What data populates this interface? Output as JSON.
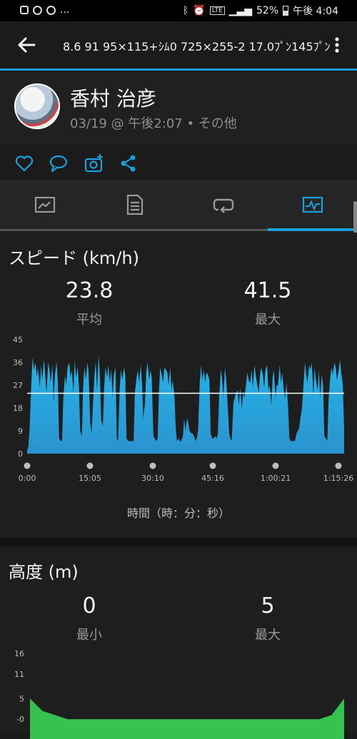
{
  "status_bar": {
    "left": "...",
    "battery": "52%",
    "time": "午後 4:04"
  },
  "app_bar": {
    "title": "8.6 91 95×115+ｼﾑ0 725×255-2 17.0ﾌﾟﾝ145ﾌﾟﾝ"
  },
  "activity": {
    "user_name": "香村 治彦",
    "meta": "03/19 @ 午後2:07 • その他"
  },
  "actions": [
    "like-icon",
    "comment-icon",
    "add-photo-icon",
    "share-icon"
  ],
  "tabs": [
    {
      "name": "overview-tab",
      "icon": "map-icon",
      "active": false
    },
    {
      "name": "details-tab",
      "icon": "list-icon",
      "active": false
    },
    {
      "name": "laps-tab",
      "icon": "laps-icon",
      "active": false
    },
    {
      "name": "charts-tab",
      "icon": "chart-icon",
      "active": true
    }
  ],
  "speed": {
    "title": "スピード (km/h)",
    "avg_value": "23.8",
    "avg_label": "平均",
    "max_value": "41.5",
    "max_label": "最大",
    "x_axis_label": "時間（時：分：秒）"
  },
  "elevation": {
    "title": "高度 (m)",
    "min_value": "0",
    "min_label": "最小",
    "max_value": "5",
    "max_label": "最大"
  },
  "colors": {
    "accent": "#1aa0dc",
    "speed_fill": "#2a93cf",
    "elevation_fill": "#37c24f"
  },
  "chart_data": [
    {
      "type": "area",
      "y_ticks": [
        "45",
        "36",
        "27",
        "18",
        "9",
        "0"
      ],
      "x_ticks": [
        "0:00",
        "15:05",
        "30:10",
        "45:16",
        "1:00:21",
        "1:15:26"
      ],
      "ylim": [
        0,
        45
      ],
      "average_line": 23.8,
      "x": [
        0,
        0.3,
        0.6,
        1.0,
        1.3,
        1.6,
        2.0,
        2.3,
        2.6,
        3.0,
        3.3,
        3.6,
        4.0,
        4.3,
        4.6,
        5.0,
        5.3,
        5.6,
        6.0,
        6.3,
        6.6,
        7.0,
        7.3,
        7.6,
        8.0,
        8.3,
        8.6,
        9.0,
        9.3,
        9.6,
        10.0,
        10.3,
        10.6,
        11.0,
        11.3,
        11.6,
        12.0,
        12.3,
        12.6,
        13.0,
        13.3,
        13.6,
        14.0,
        14.3,
        14.6,
        15.0,
        15.3,
        15.6,
        16.0,
        16.3,
        16.6,
        17.0,
        17.3,
        17.6,
        18.0,
        18.3,
        18.6,
        19.0,
        19.3,
        19.6,
        20.0,
        20.3,
        20.6,
        21.0,
        21.3,
        21.6,
        22.0,
        22.3,
        22.6,
        23.0,
        23.3,
        23.6,
        24.0,
        24.3,
        24.6,
        25.0,
        25.3,
        25.6,
        26.0,
        26.3,
        26.6,
        27.0,
        27.3,
        27.6,
        28.0,
        28.3,
        28.6,
        29.0,
        29.3,
        29.6,
        30.0,
        30.3,
        30.6,
        31.0,
        31.3,
        31.6,
        32.0,
        32.3,
        32.6,
        33.0,
        33.3,
        33.6,
        34.0,
        34.3,
        34.6,
        35.0,
        35.3,
        35.6,
        36.0,
        36.3,
        36.6,
        37.0,
        37.3,
        37.6,
        38.0,
        38.3,
        38.6,
        39.0,
        39.3,
        39.6,
        40.0,
        40.3,
        40.6,
        41.0,
        41.3,
        41.6,
        42.0,
        42.3,
        42.6,
        43.0,
        43.3,
        43.6,
        44.0,
        44.3,
        44.6,
        45.0,
        45.3,
        45.6,
        46.0,
        46.3,
        46.6,
        47.0,
        47.3,
        47.6,
        48.0,
        48.3,
        48.6,
        49.0,
        49.3,
        49.6,
        50.0,
        50.3,
        50.6,
        51.0,
        51.3,
        51.6,
        52.0,
        52.3,
        52.6,
        53.0,
        53.3,
        53.6,
        54.0,
        54.3,
        54.6,
        55.0,
        55.3,
        55.6,
        56.0,
        56.3,
        56.6,
        57.0,
        57.3,
        57.6,
        58.0,
        58.3,
        58.6,
        59.0,
        59.3,
        59.6,
        60.0,
        60.3,
        60.6,
        61.0,
        61.3,
        61.6,
        62.0,
        62.3,
        62.6,
        63.0,
        63.3,
        63.6,
        64.0,
        64.3,
        64.6,
        65.0,
        65.3,
        65.6,
        66.0,
        66.3,
        66.6,
        67.0,
        67.3,
        67.6,
        68.0,
        68.3,
        68.6,
        69.0,
        69.3,
        69.6,
        70.0,
        70.3,
        70.6,
        71.0,
        71.3,
        71.6,
        72.0,
        72.3,
        72.6,
        73.0,
        73.3,
        73.6,
        74.0,
        74.3,
        74.6,
        75.0,
        75.3
      ],
      "values": [
        1,
        3,
        10,
        28,
        38,
        33,
        36,
        30,
        34,
        26,
        35,
        29,
        37,
        31,
        24,
        36,
        33,
        28,
        35,
        20,
        31,
        36,
        28,
        6,
        5,
        5,
        22,
        31,
        27,
        34,
        36,
        30,
        33,
        24,
        37,
        30,
        34,
        27,
        9,
        7,
        26,
        34,
        29,
        36,
        32,
        12,
        8,
        18,
        31,
        36,
        25,
        39,
        30,
        13,
        11,
        26,
        34,
        30,
        35,
        28,
        33,
        22,
        31,
        34,
        6,
        5,
        26,
        33,
        29,
        34,
        31,
        6,
        5,
        5,
        5,
        5,
        5,
        24,
        30,
        33,
        28,
        35,
        27,
        14,
        20,
        32,
        36,
        29,
        33,
        30,
        7,
        6,
        5,
        6,
        24,
        34,
        31,
        28,
        34,
        33,
        32,
        27,
        34,
        25,
        29,
        22,
        10,
        5,
        6,
        5,
        5,
        7,
        14,
        9,
        14,
        12,
        9,
        8,
        8,
        7,
        5,
        6,
        9,
        28,
        35,
        29,
        33,
        28,
        32,
        31,
        29,
        8,
        6,
        6,
        7,
        6,
        8,
        22,
        33,
        30,
        22,
        34,
        29,
        20,
        8,
        6,
        5,
        20,
        22,
        24,
        25,
        19,
        26,
        18,
        24,
        22,
        27,
        32,
        29,
        28,
        33,
        26,
        35,
        31,
        28,
        24,
        31,
        34,
        31,
        26,
        33,
        35,
        25,
        27,
        19,
        30,
        33,
        22,
        27,
        27,
        35,
        28,
        32,
        24,
        22,
        28,
        18,
        6,
        5,
        5,
        5,
        5,
        8,
        9,
        10,
        15,
        18,
        26,
        36,
        31,
        28,
        35,
        33,
        36,
        23,
        34,
        29,
        25,
        33,
        22,
        31,
        27,
        7,
        6,
        5,
        21,
        30,
        34,
        31,
        36,
        34,
        29,
        33,
        37,
        32,
        27,
        9,
        9,
        8,
        8,
        8,
        6,
        4,
        3,
        1
      ]
    },
    {
      "type": "area",
      "y_ticks": [
        "16",
        "11",
        "5",
        "-0"
      ],
      "ylim": [
        -1,
        16
      ],
      "values": [
        5,
        2,
        1,
        0,
        0,
        0,
        0,
        0,
        0,
        0,
        0,
        0,
        0,
        0,
        0,
        0,
        0,
        0,
        0,
        0,
        0,
        0,
        0,
        0,
        1,
        5
      ]
    }
  ]
}
